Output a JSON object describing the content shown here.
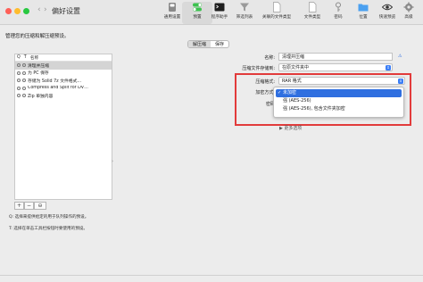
{
  "window": {
    "title": "偏好设置"
  },
  "toolbar": {
    "items": [
      {
        "label": "通用设置",
        "icon": "switch-icon"
      },
      {
        "label": "预置",
        "icon": "toggle-icon"
      },
      {
        "label": "程序助手",
        "icon": "terminal-icon"
      },
      {
        "label": "筛选列表",
        "icon": "funnel-icon"
      },
      {
        "label": "关联的文件类型",
        "icon": "document-icon"
      },
      {
        "label": "文件类型",
        "icon": "document-icon"
      },
      {
        "label": "密码",
        "icon": "key-icon"
      },
      {
        "label": "位置",
        "icon": "folder-icon"
      },
      {
        "label": "快速预览",
        "icon": "eye-icon"
      },
      {
        "label": "高级",
        "icon": "gear-icon"
      }
    ]
  },
  "description": "管理您的压缩和解压缩预设。",
  "tabs": [
    {
      "label": "解压缩",
      "selected": true
    },
    {
      "label": "保存",
      "selected": false
    }
  ],
  "preset_list": {
    "header": {
      "col1": "Q",
      "col2": "T",
      "col3": "名称"
    },
    "rows": [
      {
        "label": "清理并压缩",
        "selected": true
      },
      {
        "label": "为 PC 保存",
        "selected": false
      },
      {
        "label": "存储为 Solid 7z 文件格式…",
        "selected": false
      },
      {
        "label": "Compress and Split for DV…",
        "selected": false
      },
      {
        "label": "Zip 单独内容",
        "selected": false
      }
    ]
  },
  "list_buttons": {
    "add": "+",
    "remove": "−",
    "more": "⊖"
  },
  "help": {
    "line1": "Q:  选择来提供给定的用于队列操作的预设。",
    "line2": "T:  选择在单击工具栏按钮时要使用的预设。"
  },
  "form": {
    "name_label": "名称:",
    "name_value": "清理并压缩",
    "dest_label": "压缩文件存储到:",
    "dest_value": "在原文件夹中",
    "format_label": "压缩格式:",
    "format_value": "RAR 格式",
    "encrypt_label": "加密方式:",
    "password_label": "密码",
    "more_options": "▶ 更多选项"
  },
  "encryption_menu": {
    "options": [
      {
        "label": "未加密",
        "checked": true
      },
      {
        "label": "强 (AES-256)",
        "checked": false
      },
      {
        "label": "强 (AES-256), 包含文件夹加密",
        "checked": false
      }
    ]
  },
  "colors": {
    "accent": "#2f6fe0",
    "highlight_border": "#e23b3b"
  }
}
